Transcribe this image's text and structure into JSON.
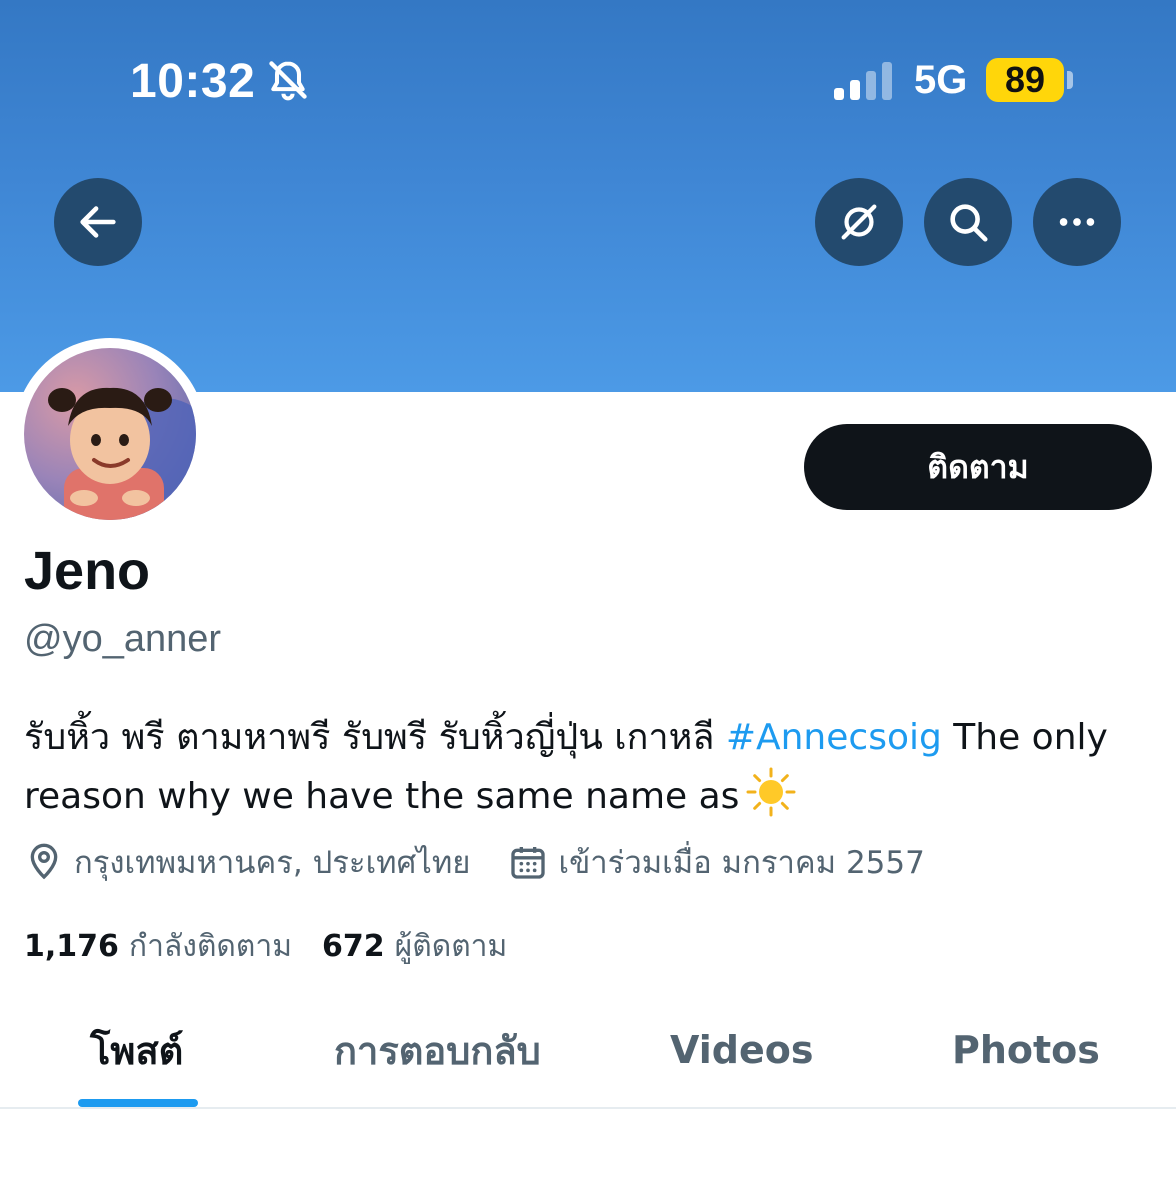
{
  "status_bar": {
    "time": "10:32",
    "network": "5G",
    "battery": "89",
    "icons": [
      "bell-slash-icon",
      "signal-icon"
    ]
  },
  "header": {
    "icons": [
      "back-arrow-icon",
      "hide-profile-icon",
      "search-icon",
      "more-icon"
    ]
  },
  "profile": {
    "follow_label": "ติดตาม",
    "display_name": "Jeno",
    "handle": "@yo_anner",
    "bio": {
      "text_before": "รับหิ้ว พรี ตามหาพรี รับพรี รับหิ้วญี่ปุ่น เกาหลี ",
      "hashtag": "#Annecsoig",
      "text_after": " The only reason why we have the same name as"
    },
    "location": "กรุงเทพมหานคร, ประเทศไทย",
    "joined": "เข้าร่วมเมื่อ มกราคม 2557",
    "following_count": "1,176",
    "following_label": "กำลังติดตาม",
    "followers_count": "672",
    "followers_label": "ผู้ติดตาม"
  },
  "tabs": [
    {
      "label": "โพสต์"
    },
    {
      "label": "การตอบกลับ"
    },
    {
      "label": "Videos"
    },
    {
      "label": "Photos"
    }
  ],
  "colors": {
    "banner_top": "#3478c4",
    "banner_bottom": "#4c9ae6",
    "accent": "#1d9bf0",
    "battery": "#ffd60a",
    "button_dark": "#0f1419",
    "muted_text": "#536471"
  }
}
